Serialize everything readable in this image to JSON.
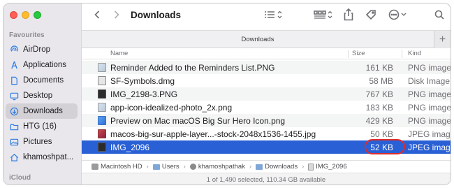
{
  "window": {
    "title": "Downloads",
    "tab_label": "Downloads"
  },
  "sidebar": {
    "favourites_title": "Favourites",
    "icloud_title": "iCloud",
    "items": [
      {
        "label": "AirDrop",
        "icon": "airdrop-icon"
      },
      {
        "label": "Applications",
        "icon": "applications-icon"
      },
      {
        "label": "Documents",
        "icon": "document-icon"
      },
      {
        "label": "Desktop",
        "icon": "desktop-icon"
      },
      {
        "label": "Downloads",
        "icon": "download-icon",
        "selected": true
      },
      {
        "label": "HTG (16)",
        "icon": "folder-icon"
      },
      {
        "label": "Pictures",
        "icon": "pictures-icon"
      },
      {
        "label": "khamoshpat...",
        "icon": "home-icon"
      }
    ]
  },
  "columns": {
    "name": "Name",
    "size": "Size",
    "kind": "Kind"
  },
  "files": [
    {
      "name": "Reminder Added to the Reminders List.PNG",
      "size": "161 KB",
      "kind": "PNG image",
      "icon": "image-file-icon"
    },
    {
      "name": "SF-Symbols.dmg",
      "size": "58 MB",
      "kind": "Disk Image",
      "icon": "disk-image-icon"
    },
    {
      "name": "IMG_2198-3.PNG",
      "size": "767 KB",
      "kind": "PNG image",
      "icon": "image-file-icon"
    },
    {
      "name": "app-icon-idealized-photo_2x.png",
      "size": "183 KB",
      "kind": "PNG image",
      "icon": "image-file-icon"
    },
    {
      "name": "Preview on Mac macOS Big Sur Hero Icon.png",
      "size": "429 KB",
      "kind": "PNG image",
      "icon": "image-file-icon"
    },
    {
      "name": "macos-big-sur-apple-layer...-stock-2048x1536-1455.jpg",
      "size": "50 KB",
      "kind": "JPEG image",
      "icon": "jpeg-file-icon"
    },
    {
      "name": "IMG_2096",
      "size": "52 KB",
      "kind": "JPEG image",
      "icon": "jpeg-file-icon",
      "selected": true
    }
  ],
  "path": [
    "Macintosh HD",
    "Users",
    "khamoshpathak",
    "Downloads",
    "IMG_2096"
  ],
  "status": "1 of 1,490 selected, 110.34 GB available",
  "colors": {
    "selection": "#2960d5",
    "highlight_ring": "#e02b2b"
  }
}
